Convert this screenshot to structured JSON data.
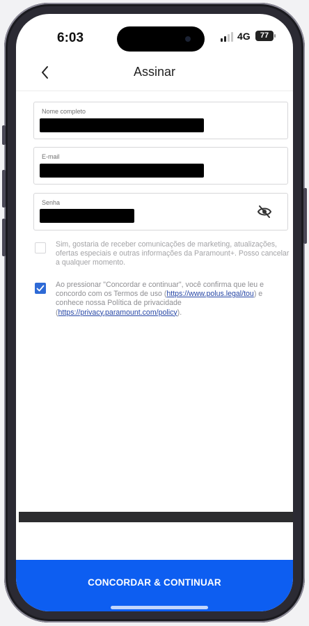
{
  "status_bar": {
    "time": "6:03",
    "network": "4G",
    "battery": "77"
  },
  "header": {
    "title": "Assinar",
    "back_icon": "chevron-left-icon"
  },
  "form": {
    "full_name": {
      "label": "Nome completo",
      "value": ""
    },
    "email": {
      "label": "E-mail",
      "value": ""
    },
    "password": {
      "label": "Senha",
      "value": "",
      "toggle_icon": "eye-off-icon"
    }
  },
  "consents": {
    "marketing": {
      "checked": false,
      "text": "Sim, gostaria de receber comunicações de marketing, atualizações, ofertas especiais e outras informações da Paramount+. Posso cancelar a qualquer momento."
    },
    "terms": {
      "checked": true,
      "text_1": "Ao pressionar \"Concordar e continuar\", você confirma que leu e concordo com os Termos de uso (",
      "terms_link": "https://www.polus.legal/tou",
      "text_2": ") e conhece nossa Política de privacidade (",
      "privacy_link": "https://privacy.paramount.com/policy",
      "text_3": ")."
    }
  },
  "cta": {
    "label": "CONCORDAR & CONTINUAR"
  },
  "colors": {
    "accent": "#0d5ef1",
    "checkbox_checked": "#2e6ad6",
    "link": "#2747a6"
  }
}
